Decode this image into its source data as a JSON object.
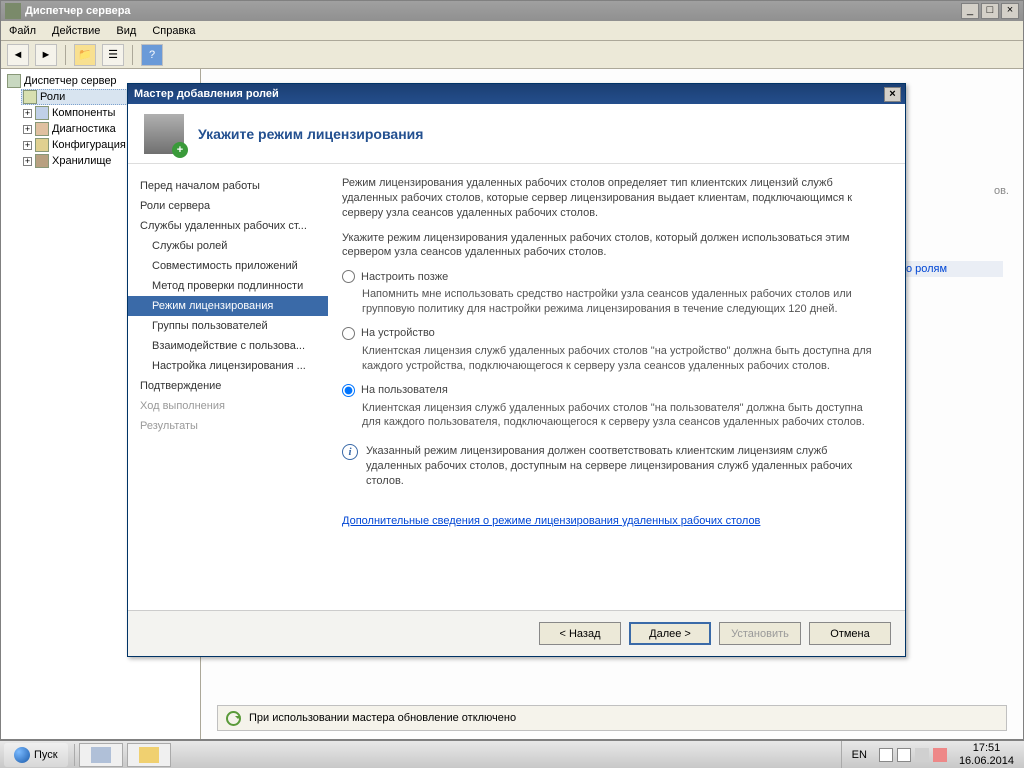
{
  "window": {
    "title": "Диспетчер сервера",
    "menu": {
      "file": "Файл",
      "action": "Действие",
      "view": "Вид",
      "help": "Справка"
    }
  },
  "tree": {
    "root": "Диспетчер сервер",
    "roles": "Роли",
    "components": "Компоненты",
    "diagnostics": "Диагностика",
    "configuration": "Конфигурация",
    "storage": "Хранилище"
  },
  "content": {
    "truncated": "ов.",
    "by_roles": "по ролям"
  },
  "status": {
    "text": "При использовании мастера обновление отключено"
  },
  "dialog": {
    "title": "Мастер добавления ролей",
    "heading": "Укажите режим лицензирования",
    "nav": {
      "before": "Перед началом работы",
      "server_roles": "Роли сервера",
      "rds": "Службы удаленных рабочих ст...",
      "role_services": "Службы ролей",
      "app_compat": "Совместимость приложений",
      "auth_method": "Метод проверки подлинности",
      "licensing_mode": "Режим лицензирования",
      "user_groups": "Группы пользователей",
      "client_exp": "Взаимодействие с пользова...",
      "lic_config": "Настройка лицензирования ...",
      "confirm": "Подтверждение",
      "progress": "Ход выполнения",
      "results": "Результаты"
    },
    "intro1": "Режим лицензирования удаленных рабочих столов определяет тип клиентских лицензий служб удаленных рабочих столов, которые сервер лицензирования выдает клиентам, подключающимся к серверу узла сеансов удаленных рабочих столов.",
    "intro2": "Укажите режим лицензирования удаленных рабочих столов, который должен использоваться этим сервером узла сеансов удаленных рабочих столов.",
    "opt_later": {
      "label": "Настроить позже",
      "desc": "Напомнить мне использовать средство настройки узла сеансов удаленных рабочих столов или групповую политику для настройки режима лицензирования в течение следующих 120 дней."
    },
    "opt_device": {
      "label": "На устройство",
      "desc": "Клиентская лицензия служб удаленных рабочих столов \"на устройство\" должна быть доступна для каждого устройства, подключающегося к серверу узла сеансов удаленных рабочих столов."
    },
    "opt_user": {
      "label": "На пользователя",
      "desc": "Клиентская лицензия служб удаленных рабочих столов \"на пользователя\" должна быть доступна для каждого пользователя, подключающегося к серверу узла сеансов удаленных рабочих столов."
    },
    "info": "Указанный режим лицензирования должен соответствовать клиентским лицензиям служб удаленных рабочих столов, доступным на сервере лицензирования служб удаленных рабочих столов.",
    "learn": "Дополнительные сведения о режиме лицензирования удаленных рабочих столов",
    "buttons": {
      "back": "< Назад",
      "next": "Далее >",
      "install": "Установить",
      "cancel": "Отмена"
    }
  },
  "taskbar": {
    "start": "Пуск",
    "lang": "EN",
    "time": "17:51",
    "date": "16.06.2014"
  }
}
